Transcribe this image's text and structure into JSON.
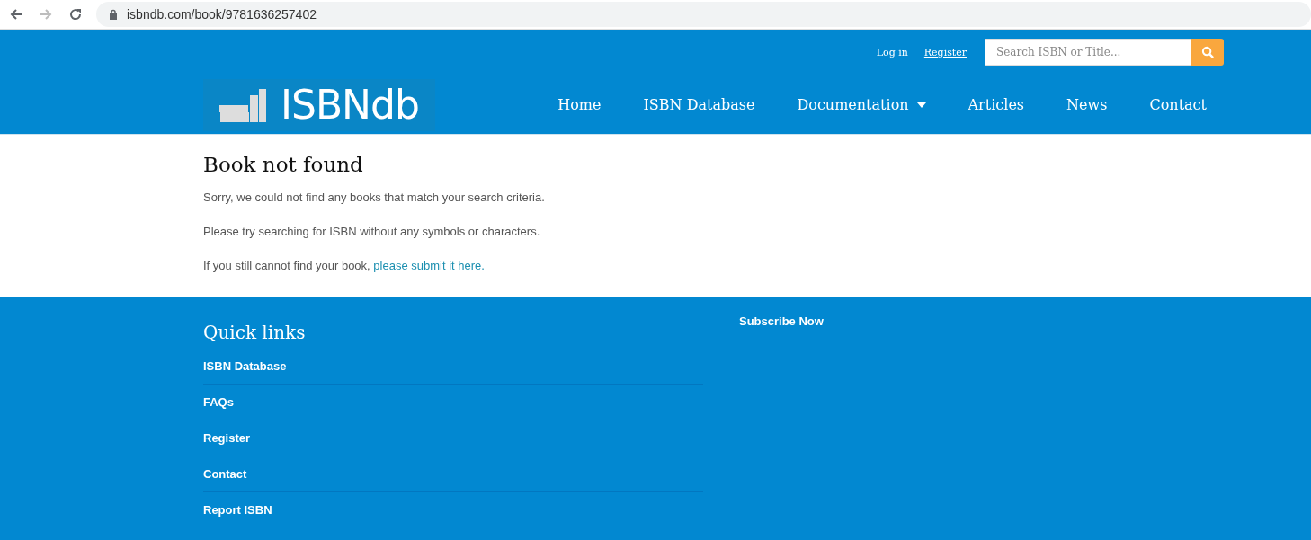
{
  "browser": {
    "url": "isbndb.com/book/9781636257402"
  },
  "top_bar": {
    "login": "Log in",
    "register": "Register",
    "search": {
      "placeholder": "Search ISBN or Title..."
    }
  },
  "logo": {
    "text": "ISBNdb"
  },
  "nav": [
    {
      "label": "Home",
      "dropdown": false
    },
    {
      "label": "ISBN Database",
      "dropdown": false
    },
    {
      "label": "Documentation",
      "dropdown": true
    },
    {
      "label": "Articles",
      "dropdown": false
    },
    {
      "label": "News",
      "dropdown": false
    },
    {
      "label": "Contact",
      "dropdown": false
    }
  ],
  "content": {
    "title": "Book not found",
    "paragraphs": [
      "Sorry, we could not find any books that match your search criteria.",
      "Please try searching for ISBN without any symbols or characters."
    ],
    "submit": {
      "text": "If you still cannot find your book,",
      "link": "please submit it here."
    }
  },
  "footer": {
    "quick_links_title": "Quick links",
    "quick_links": [
      "ISBN Database",
      "FAQs",
      "Register",
      "Contact",
      "Report ISBN"
    ],
    "subscribe": "Subscribe Now"
  }
}
